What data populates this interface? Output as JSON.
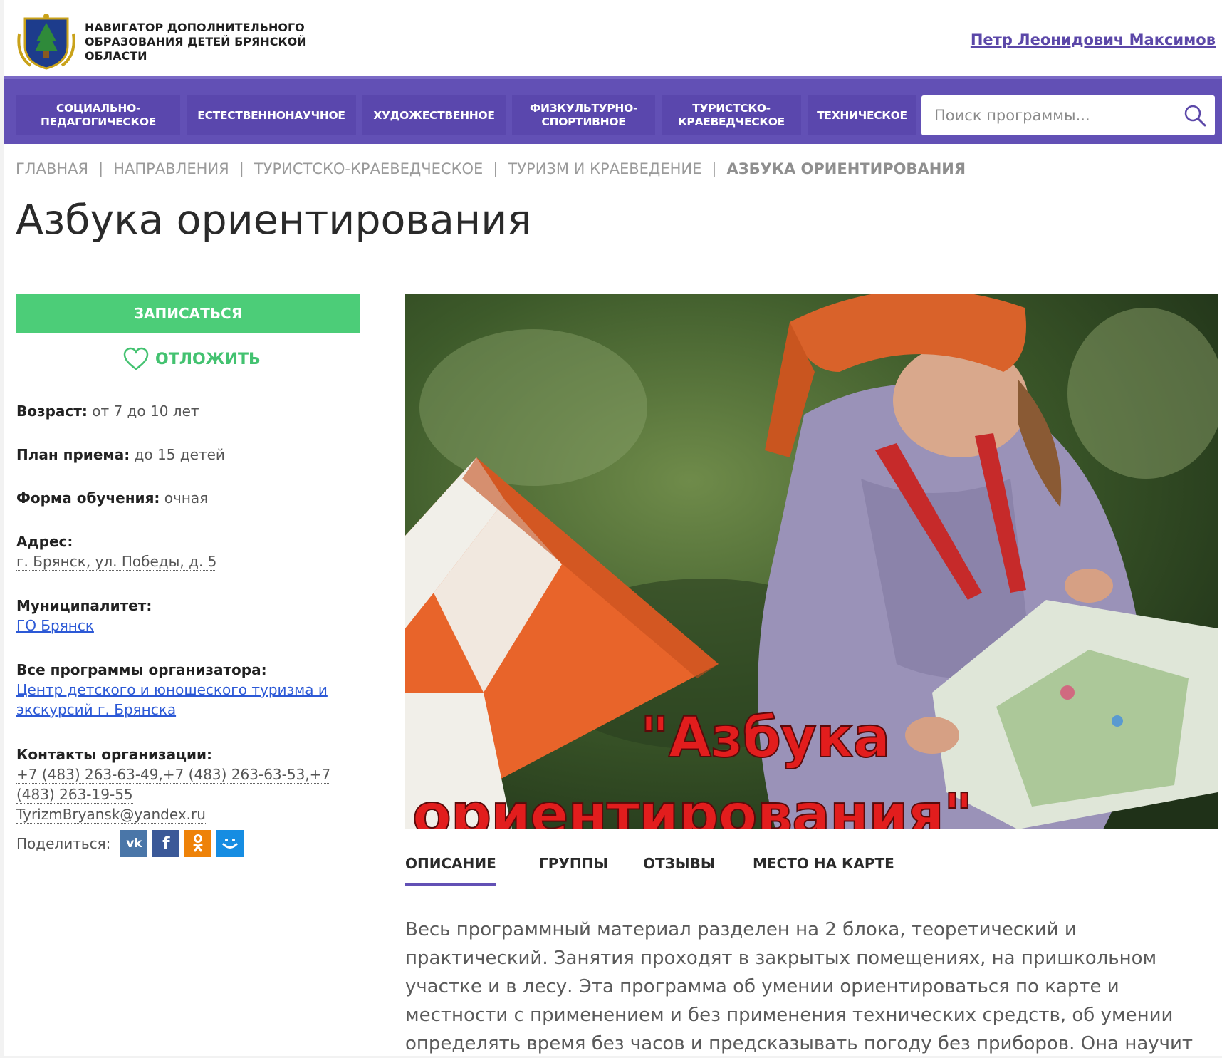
{
  "header": {
    "site_title": "НАВИГАТОР ДОПОЛНИТЕЛЬНОГО ОБРАЗОВАНИЯ ДЕТЕЙ БРЯНСКОЙ ОБЛАСТИ",
    "user_name": "Петр Леонидович Максимов"
  },
  "nav": {
    "items": [
      {
        "label": "СОЦИАЛЬНО-ПЕДАГОГИЧЕСКОЕ"
      },
      {
        "label": "ЕСТЕСТВЕННОНАУЧНОЕ"
      },
      {
        "label": "ХУДОЖЕСТВЕННОЕ"
      },
      {
        "label": "ФИЗКУЛЬТУРНО-СПОРТИВНОЕ"
      },
      {
        "label": "ТУРИСТСКО-КРАЕВЕДЧЕСКОЕ"
      },
      {
        "label": "ТЕХНИЧЕСКОЕ"
      }
    ],
    "search_placeholder": "Поиск программы..."
  },
  "breadcrumb": {
    "items": [
      "ГЛАВНАЯ",
      "НАПРАВЛЕНИЯ",
      "ТУРИСТСКО-КРАЕВЕДЧЕСКОЕ",
      "ТУРИЗМ И КРАЕВЕДЕНИЕ"
    ],
    "current": "АЗБУКА ОРИЕНТИРОВАНИЯ"
  },
  "page_title": "Азбука ориентирования",
  "sidebar": {
    "enroll_label": "ЗАПИСАТЬСЯ",
    "postpone_label": "ОТЛОЖИТЬ",
    "age_label": "Возраст:",
    "age_value": "от 7 до 10 лет",
    "plan_label": "План приема:",
    "plan_value": "до 15 детей",
    "form_label": "Форма обучения:",
    "form_value": "очная",
    "address_label": "Адрес:",
    "address_value": "г. Брянск, ул. Победы, д. 5",
    "municipality_label": "Муниципалитет:",
    "municipality_value": "ГО Брянск",
    "programs_label": "Все программы организатора:",
    "programs_value": "Центр детского и юношеского туризма и экскурсий г. Брянска",
    "contacts_label": "Контакты организации:",
    "contacts_phones": "+7 (483) 263-63-49,+7 (483) 263-63-53,+7 (483) 263-19-55",
    "contacts_email": "TyrizmBryansk@yandex.ru",
    "share_label": "Поделиться:",
    "share_icons": [
      "vk-icon",
      "facebook-icon",
      "odnoklassniki-icon",
      "mailru-icon"
    ]
  },
  "hero": {
    "caption_line1": "\"Азбука",
    "caption_line2": "ориентирования\""
  },
  "tabs": [
    {
      "label": "ОПИСАНИЕ"
    },
    {
      "label": "ГРУППЫ"
    },
    {
      "label": "ОТЗЫВЫ"
    },
    {
      "label": "МЕСТО НА КАРТЕ"
    }
  ],
  "description": "Весь программный материал разделен на 2 блока, теоретический и практический. Занятия проходят в закрытых помещениях, на пришкольном участке и в лесу. Эта программа об умении ориентироваться по карте и местности с применением и без применения технических средств, об умении определять время без часов и предсказывать погоду без приборов. Она научит",
  "colors": {
    "nav_bg": "#6250b5",
    "enroll": "#4ccd78",
    "link": "#2c59d6",
    "user_link": "#5b47a8"
  }
}
